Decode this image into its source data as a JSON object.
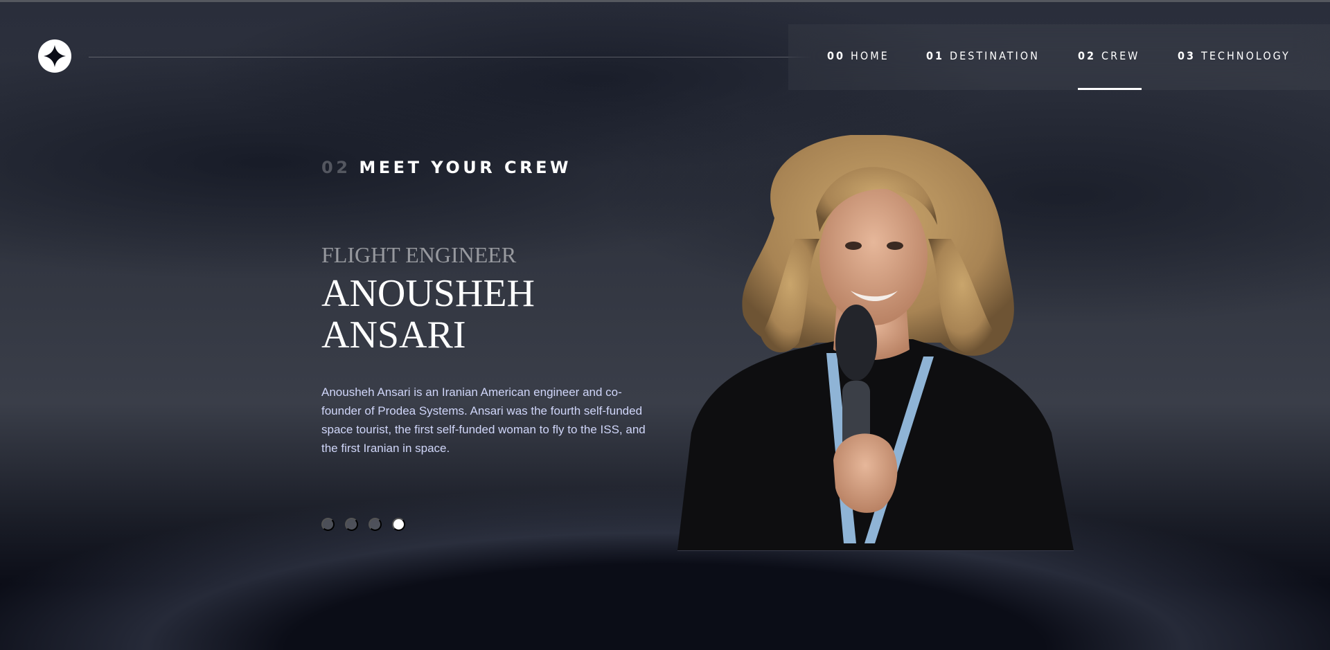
{
  "nav": {
    "items": [
      {
        "num": "00",
        "label": "HOME"
      },
      {
        "num": "01",
        "label": "DESTINATION"
      },
      {
        "num": "02",
        "label": "CREW"
      },
      {
        "num": "03",
        "label": "TECHNOLOGY"
      }
    ],
    "active_index": 2
  },
  "page": {
    "eyebrow_num": "02",
    "eyebrow_text": "MEET YOUR CREW"
  },
  "crew": {
    "role": "Flight Engineer",
    "name": "Anousheh Ansari",
    "bio": "Anousheh Ansari is an Iranian American engineer and co-founder of Prodea Systems. Ansari was the fourth self-funded space tourist, the first self-funded woman to fly to the ISS, and the first Iranian in space.",
    "slide_count": 4,
    "active_slide": 3
  },
  "icons": {
    "logo": "four-point-star-icon",
    "portrait": "crew-portrait-image"
  },
  "colors": {
    "background": "#0b0d17",
    "accent_text": "#d0d6f9",
    "white": "#ffffff"
  }
}
